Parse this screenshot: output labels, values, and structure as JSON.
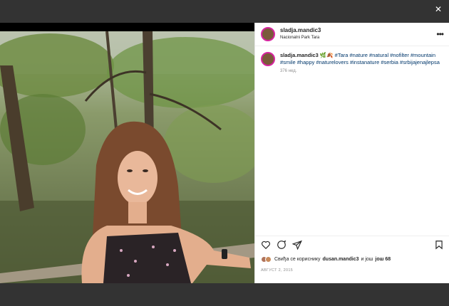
{
  "post": {
    "username": "sladja.mandic3",
    "location": "Nacionalni Park Tara",
    "more_icon": "more-horizontal-icon"
  },
  "caption": {
    "username": "sladja.mandic3",
    "emojis": "🌿🍂",
    "hashtags": "#Tara #nature #natural #nofilter #mountain #smile #happy #naturelovers #instanature #serbia #srbijajenajlepsa",
    "time_ago": "376 нед."
  },
  "actions": {
    "like_icon": "heart-icon",
    "comment_icon": "comment-icon",
    "share_icon": "share-icon",
    "save_icon": "bookmark-icon"
  },
  "likes": {
    "prefix": "Свиђа се кориснику",
    "user": "dusan.mandic3",
    "middle": "и још",
    "count": "још 68"
  },
  "date": "АВГУСТ 2, 2015",
  "close_label": "✕"
}
